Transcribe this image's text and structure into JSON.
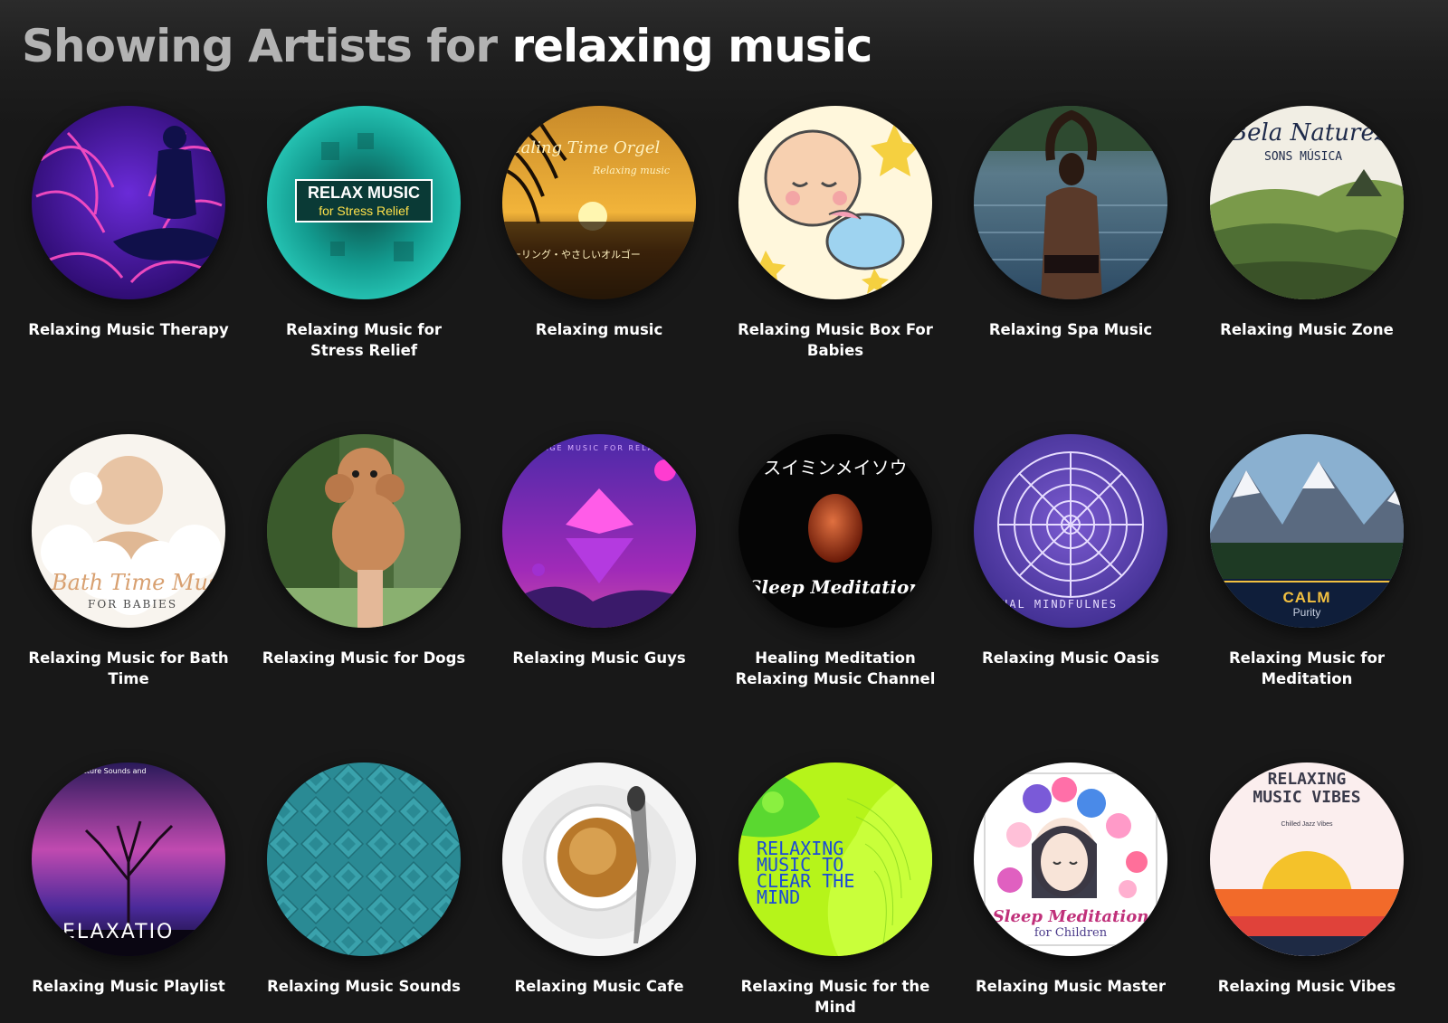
{
  "header": {
    "prefix": "Showing Artists for ",
    "query": "relaxing music"
  },
  "artists": [
    {
      "name": "Relaxing Music Therapy",
      "icon": "meditation-figure-image"
    },
    {
      "name": "Relaxing Music for Stress Relief",
      "icon": "relax-music-logo-image",
      "art_text_1": "RELAX MUSIC",
      "art_text_2": "for Stress Relief"
    },
    {
      "name": "Relaxing music",
      "icon": "sunset-palm-image",
      "art_text_1": "ealing Time Orgel",
      "art_text_2": "Relaxing music",
      "art_text_3": "ーリング・やさしいオルゴー"
    },
    {
      "name": "Relaxing Music Box For Babies",
      "icon": "sleeping-baby-image"
    },
    {
      "name": "Relaxing Spa Music",
      "icon": "infinity-pool-woman-image"
    },
    {
      "name": "Relaxing Music Zone",
      "icon": "green-landscape-image",
      "art_text_1": "Bela Naturez",
      "art_text_2": "SONS MÚSICA"
    },
    {
      "name": "Relaxing Music for Bath Time",
      "icon": "bath-baby-image",
      "art_text_1": "Bath Time Mus",
      "art_text_2": "FOR BABIES"
    },
    {
      "name": "Relaxing Music for Dogs",
      "icon": "poodle-puppy-image"
    },
    {
      "name": "Relaxing Music Guys",
      "icon": "purple-diamond-image",
      "art_text_1": "AGE MUSIC FOR RELAX"
    },
    {
      "name": "Healing Meditation Relaxing Music Channel",
      "icon": "red-moon-image",
      "art_text_1": "スイミンメイソウ",
      "art_text_2": "Sleep Meditation"
    },
    {
      "name": "Relaxing Music Oasis",
      "icon": "mandala-image",
      "art_text_1": "NAL MINDFULNES"
    },
    {
      "name": "Relaxing Music for Meditation",
      "icon": "mountain-forest-image",
      "art_text_1": "CALM",
      "art_text_2": "Purity"
    },
    {
      "name": "Relaxing Music Playlist",
      "icon": "galaxy-tree-image",
      "art_text_1": "ELAXATIO",
      "art_text_2": "Nature Sounds and"
    },
    {
      "name": "Relaxing Music Sounds",
      "icon": "teal-pattern-image"
    },
    {
      "name": "Relaxing Music Cafe",
      "icon": "coffee-cup-image"
    },
    {
      "name": "Relaxing Music for the Mind",
      "icon": "neon-face-image",
      "art_text_1": "RELAXING",
      "art_text_2": "MUSIC TO",
      "art_text_3": "CLEAR THE",
      "art_text_4": "MIND"
    },
    {
      "name": "Relaxing Music Master",
      "icon": "flower-girl-image",
      "art_text_1": "Sleep Meditation",
      "art_text_2": "for Children"
    },
    {
      "name": "Relaxing Music Vibes",
      "icon": "sunset-stripes-image",
      "art_text_1": "RELAXING",
      "art_text_2": "MUSIC VIBES",
      "art_text_3": "Chilled Jazz Vibes"
    }
  ]
}
